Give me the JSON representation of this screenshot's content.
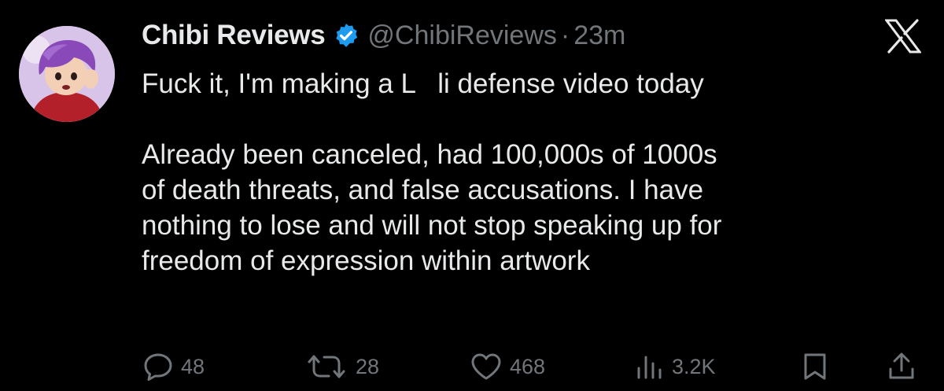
{
  "author": {
    "display_name": "Chibi Reviews",
    "handle": "@ChibiReviews",
    "separator": "·",
    "time": "23m",
    "verified": true,
    "avatar": "cartoon-avatar-purple-hair"
  },
  "platform_logo": "x-logo",
  "tweet": {
    "text": "Fuck it, I'm making a L  li defense video today\n\nAlready been canceled, had 100,000s of 1000s\nof death threats, and false accusations. I have\nnothing to lose and will not stop speaking up for\nfreedom of expression within artwork"
  },
  "actions": {
    "reply": {
      "icon": "reply-icon",
      "count": "48"
    },
    "retweet": {
      "icon": "retweet-icon",
      "count": "28"
    },
    "like": {
      "icon": "heart-icon",
      "count": "468"
    },
    "views": {
      "icon": "views-icon",
      "count": "3.2K"
    },
    "bookmark": {
      "icon": "bookmark-icon"
    },
    "share": {
      "icon": "share-icon"
    }
  },
  "colors": {
    "background": "#000000",
    "primary_text": "#e7e9ea",
    "secondary_text": "#71767b",
    "verified_blue": "#1d9bf0"
  }
}
